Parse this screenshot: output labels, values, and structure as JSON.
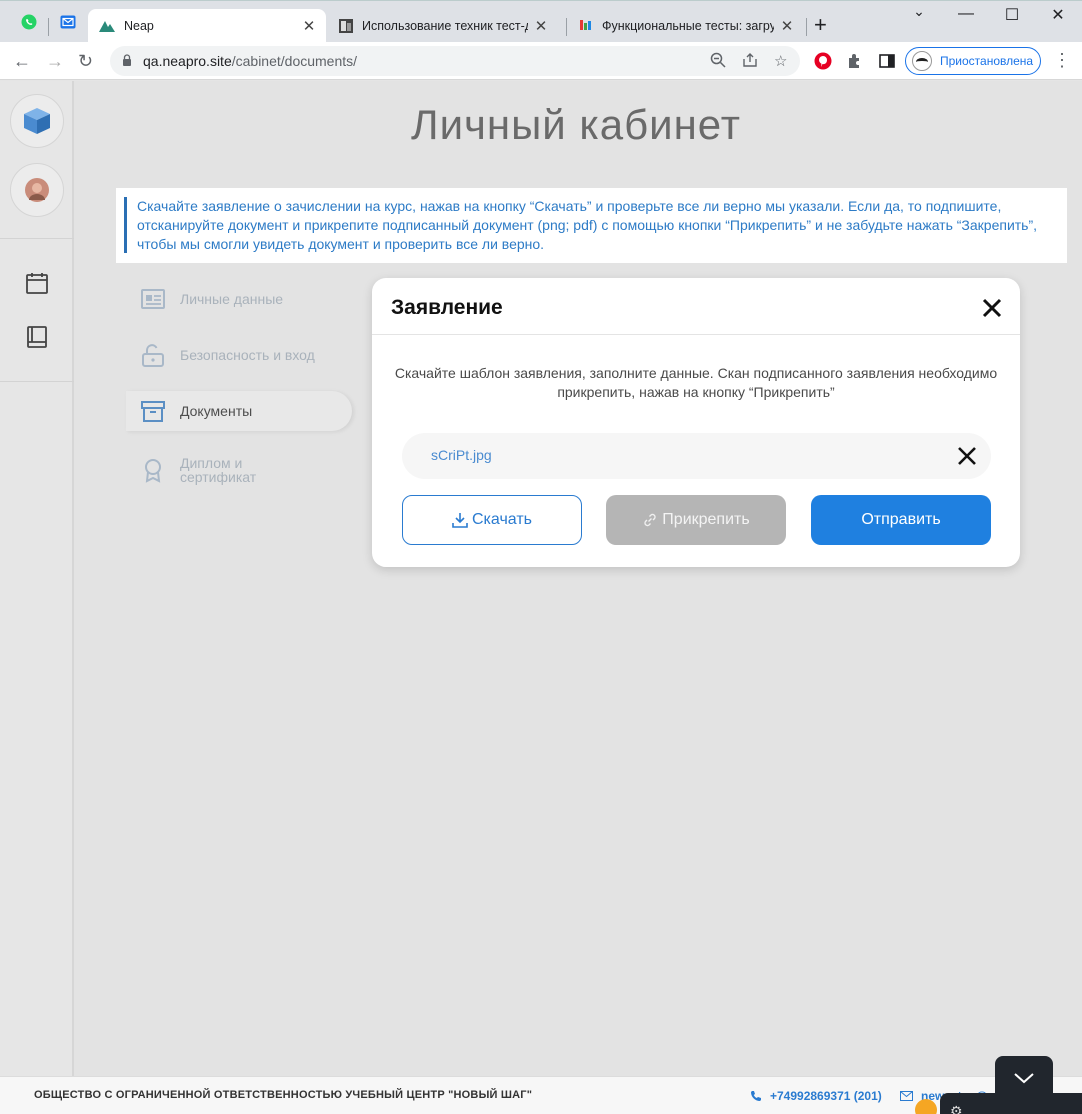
{
  "browser": {
    "tabs": [
      {
        "title": "Neap",
        "active": true
      },
      {
        "title": "Использование техник тест-диз",
        "active": false
      },
      {
        "title": "Функциональные тесты: загрузк",
        "active": false
      }
    ],
    "address": {
      "host": "qa.neapro.site",
      "path": "/cabinet/documents/"
    },
    "profile_label": "Приостановлена",
    "window_controls": {
      "minimize": "—",
      "maximize": "☐",
      "close": "✕"
    }
  },
  "page": {
    "title": "Личный кабинет",
    "notice": "Скачайте заявление о зачислении на курс, нажав на кнопку “Скачать” и проверьте все ли верно мы указали. Если да, то подпишите, отсканируйте документ и прикрепите подписанный документ (png; pdf) с помощью кнопки “Прикрепить” и не забудьте нажать “Закрепить”, чтобы мы смогли увидеть документ и проверить все ли верно.",
    "menu": [
      {
        "label": "Личные данные",
        "icon": "id-card-icon",
        "active": false
      },
      {
        "label": "Безопасность и вход",
        "icon": "lock-icon",
        "active": false
      },
      {
        "label": "Документы",
        "icon": "archive-icon",
        "active": true
      },
      {
        "label": "Диплом и сертификат",
        "icon": "award-icon",
        "active": false
      }
    ]
  },
  "modal": {
    "title": "Заявление",
    "description": "Скачайте шаблон заявления, заполните данные. Скан подписанного заявления необходимо прикрепить, нажав на кнопку “Прикрепить”",
    "file_name": "sCriPt.jpg",
    "buttons": {
      "download": "Скачать",
      "attach": "Прикрепить",
      "send": "Отправить"
    }
  },
  "footer": {
    "company": "ОБЩЕСТВО С ОГРАНИЧЕННОЙ ОТВЕТСТВЕННОСТЬЮ УЧЕБНЫЙ ЦЕНТР \"НОВЫЙ ШАГ\"",
    "phone": "+74992869371 (201)",
    "email": "new_step@"
  },
  "colors": {
    "accent": "#1f80e0",
    "link": "#2d7bc6",
    "disabled": "#b5b5b5",
    "chrome_tabbar": "#dee1e6"
  }
}
